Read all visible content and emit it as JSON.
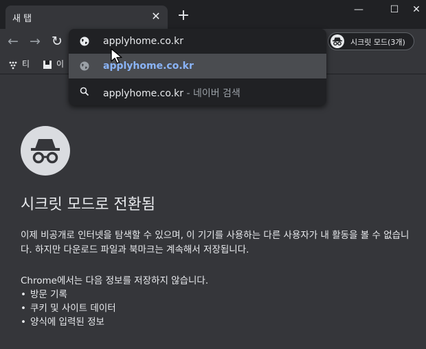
{
  "tab": {
    "title": "새 탭",
    "close_glyph": "✕"
  },
  "newtab_glyph": "+",
  "window": {
    "minimize_glyph": "—",
    "maximize_glyph": "☐",
    "close_glyph": "✕"
  },
  "nav": {
    "back_glyph": "←",
    "forward_glyph": "→",
    "reload_glyph": "↻"
  },
  "incognito_pill": {
    "label": "시크릿 모드(3개)",
    "icon": "incognito-icon"
  },
  "bookmarks": [
    {
      "label": "티",
      "icon": "dots-icon"
    },
    {
      "label": "이",
      "icon": "bookmark-icon"
    }
  ],
  "omnibox": {
    "input_value": "applyhome.co.kr",
    "suggestions": [
      {
        "text": "applyhome.co.kr",
        "icon": "globe-icon"
      },
      {
        "text": "applyhome.co.kr",
        "suffix": " - 네이버 검색",
        "icon": "search-icon"
      }
    ]
  },
  "content": {
    "heading": "시크릿 모드로 전환됨",
    "para1": "이제 비공개로 인터넷을 탐색할 수 있으며, 이 기기를 사용하는 다른 사용자가 내 활동을 볼 수 없습니다. 하지만 다운로드 파일과 북마크는 계속해서 저장됩니다.",
    "para2": "Chrome에서는 다음 정보를 저장하지 않습니다.",
    "list": [
      "방문 기록",
      "쿠키 및 사이트 데이터",
      "양식에 입력된 정보"
    ]
  },
  "colors": {
    "accent_link": "#8ab4f8",
    "background": "#35363a",
    "frame": "#202124"
  }
}
